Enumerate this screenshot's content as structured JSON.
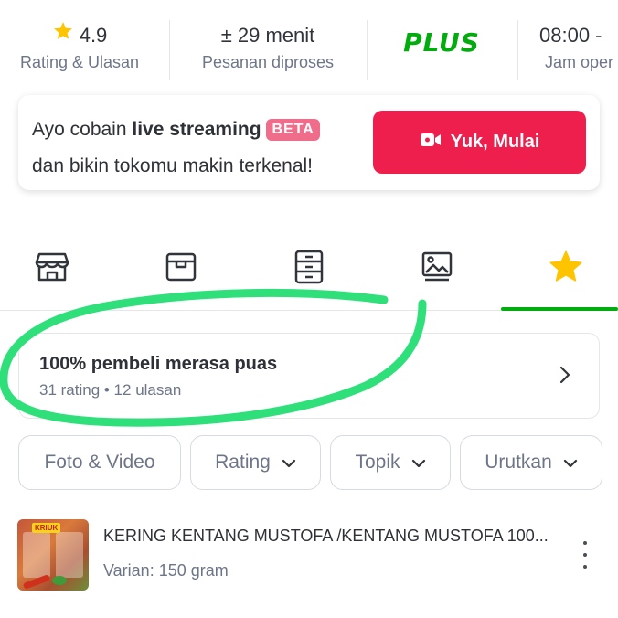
{
  "stats": {
    "rating": {
      "value": "4.9",
      "label": "Rating & Ulasan"
    },
    "process": {
      "value": "± 29 menit",
      "label": "Pesanan diproses"
    },
    "plus": {
      "logo": "PLUS"
    },
    "hours": {
      "value": "08:00 -",
      "label": "Jam oper"
    }
  },
  "live": {
    "line1_prefix": "Ayo cobain ",
    "line1_bold": "live streaming",
    "beta": "BETA",
    "line2": "dan bikin tokomu makin terkenal!",
    "button": "Yuk, Mulai"
  },
  "tabs": [
    {
      "icon": "store-icon"
    },
    {
      "icon": "product-box-icon"
    },
    {
      "icon": "catalog-icon"
    },
    {
      "icon": "gallery-icon"
    },
    {
      "icon": "star-icon",
      "active": true
    }
  ],
  "satisfaction": {
    "title": "100% pembeli merasa puas",
    "subtitle": "31 rating • 12 ulasan"
  },
  "filters": {
    "foto": "Foto & Video",
    "rating": "Rating",
    "topik": "Topik",
    "urutkan": "Urutkan"
  },
  "review": {
    "product_name": "KERING KENTANG MUSTOFA /KENTANG MUSTOFA 100...",
    "variant": "Varian: 150 gram",
    "thumb_badge": "KRIUK"
  },
  "colors": {
    "accent_green": "#03ac0e",
    "live_red": "#ee1f4d",
    "beta_pink": "#ef6c8a",
    "star_yellow": "#ffc400",
    "annotation_green": "#2fe07a"
  }
}
